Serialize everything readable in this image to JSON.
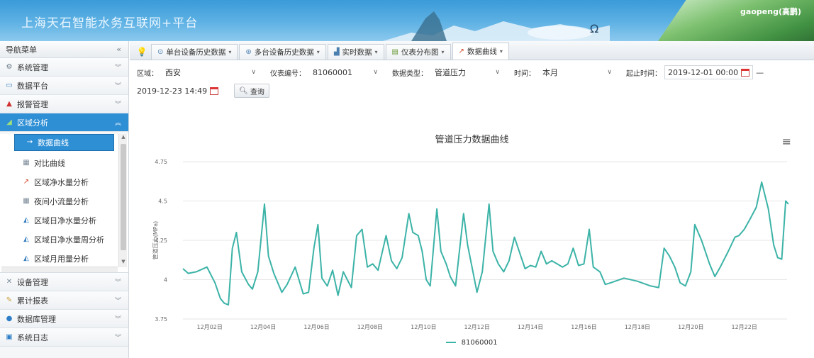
{
  "header": {
    "title": "上海天石智能水务互联网+平台",
    "user": "gaopeng(高鹏)",
    "user_extra": ""
  },
  "sidebar": {
    "title": "导航菜单",
    "collapse": "«",
    "groups": [
      {
        "label": "系统管理",
        "icon": "gear-icon"
      },
      {
        "label": "数据平台",
        "icon": "monitor-icon"
      },
      {
        "label": "报警管理",
        "icon": "alarm-icon"
      },
      {
        "label": "区域分析",
        "icon": "chart-icon"
      }
    ],
    "sub_items": [
      {
        "label": "数据曲线"
      },
      {
        "label": "对比曲线"
      },
      {
        "label": "区域净水量分析"
      },
      {
        "label": "夜间小流量分析"
      },
      {
        "label": "区域日净水量分析"
      },
      {
        "label": "区域日净水量周分析"
      },
      {
        "label": "区域月用量分析"
      }
    ],
    "groups_after": [
      {
        "label": "设备管理",
        "icon": "wrench-icon"
      },
      {
        "label": "累计报表",
        "icon": "report-icon"
      },
      {
        "label": "数据库管理",
        "icon": "database-icon"
      },
      {
        "label": "系统日志",
        "icon": "log-icon"
      }
    ]
  },
  "tabs": [
    {
      "label": "单台设备历史数据",
      "icon": "clock-icon"
    },
    {
      "label": "多台设备历史数据",
      "icon": "clock-icon"
    },
    {
      "label": "实时数据",
      "icon": "chart-icon"
    },
    {
      "label": "仪表分布图",
      "icon": "map-icon"
    },
    {
      "label": "数据曲线",
      "icon": "line-chart-icon"
    }
  ],
  "filters": {
    "region_label": "区域：",
    "region_value": "西安",
    "meter_label": "仪表编号：",
    "meter_value": "81060001",
    "type_label": "数据类型：",
    "type_value": "管道压力",
    "period_label": "时间：",
    "period_value": "本月",
    "start_label": "起止时间：",
    "start_value": "2019-12-01 00:00",
    "sep": "—",
    "end_value": "2019-12-23 14:49",
    "query_label": "查询"
  },
  "chart_data": {
    "type": "line",
    "title": "管道压力数据曲线",
    "ylabel": "管道压力(MPa)",
    "ylim": [
      3.75,
      4.75
    ],
    "yticks": [
      "3.75",
      "4",
      "4.25",
      "4.5",
      "4.75"
    ],
    "xticks": [
      "12月02日",
      "12月04日",
      "12月06日",
      "12月08日",
      "12月10日",
      "12月12日",
      "12月14日",
      "12月16日",
      "12月18日",
      "12月20日",
      "12月22日"
    ],
    "x_start_day": 1,
    "x_end_day": 23.6,
    "series": [
      {
        "name": "81060001",
        "color": "#3cb3a7",
        "points": [
          [
            1.0,
            4.07
          ],
          [
            1.2,
            4.04
          ],
          [
            1.5,
            4.05
          ],
          [
            1.9,
            4.08
          ],
          [
            2.2,
            3.98
          ],
          [
            2.4,
            3.88
          ],
          [
            2.55,
            3.85
          ],
          [
            2.7,
            3.84
          ],
          [
            2.85,
            4.2
          ],
          [
            3.0,
            4.3
          ],
          [
            3.2,
            4.05
          ],
          [
            3.45,
            3.97
          ],
          [
            3.6,
            3.94
          ],
          [
            3.8,
            4.05
          ],
          [
            4.05,
            4.48
          ],
          [
            4.2,
            4.15
          ],
          [
            4.4,
            4.04
          ],
          [
            4.7,
            3.92
          ],
          [
            4.9,
            3.97
          ],
          [
            5.2,
            4.08
          ],
          [
            5.5,
            3.91
          ],
          [
            5.7,
            3.92
          ],
          [
            5.9,
            4.2
          ],
          [
            6.05,
            4.35
          ],
          [
            6.2,
            4.01
          ],
          [
            6.4,
            3.96
          ],
          [
            6.6,
            4.06
          ],
          [
            6.8,
            3.9
          ],
          [
            7.0,
            4.05
          ],
          [
            7.15,
            4.0
          ],
          [
            7.3,
            3.95
          ],
          [
            7.5,
            4.28
          ],
          [
            7.7,
            4.32
          ],
          [
            7.9,
            4.08
          ],
          [
            8.1,
            4.1
          ],
          [
            8.3,
            4.06
          ],
          [
            8.6,
            4.28
          ],
          [
            8.8,
            4.12
          ],
          [
            9.0,
            4.07
          ],
          [
            9.2,
            4.14
          ],
          [
            9.45,
            4.42
          ],
          [
            9.6,
            4.3
          ],
          [
            9.8,
            4.28
          ],
          [
            9.95,
            4.18
          ],
          [
            10.1,
            4.0
          ],
          [
            10.25,
            3.96
          ],
          [
            10.5,
            4.45
          ],
          [
            10.65,
            4.18
          ],
          [
            10.85,
            4.1
          ],
          [
            11.0,
            4.02
          ],
          [
            11.2,
            3.96
          ],
          [
            11.5,
            4.42
          ],
          [
            11.65,
            4.22
          ],
          [
            11.85,
            4.05
          ],
          [
            12.0,
            3.92
          ],
          [
            12.2,
            4.05
          ],
          [
            12.45,
            4.48
          ],
          [
            12.6,
            4.18
          ],
          [
            12.8,
            4.1
          ],
          [
            13.0,
            4.05
          ],
          [
            13.2,
            4.12
          ],
          [
            13.4,
            4.27
          ],
          [
            13.6,
            4.17
          ],
          [
            13.8,
            4.07
          ],
          [
            14.0,
            4.09
          ],
          [
            14.2,
            4.08
          ],
          [
            14.4,
            4.18
          ],
          [
            14.6,
            4.1
          ],
          [
            14.8,
            4.12
          ],
          [
            15.0,
            4.1
          ],
          [
            15.2,
            4.08
          ],
          [
            15.4,
            4.1
          ],
          [
            15.6,
            4.2
          ],
          [
            15.8,
            4.09
          ],
          [
            16.0,
            4.1
          ],
          [
            16.2,
            4.32
          ],
          [
            16.35,
            4.08
          ],
          [
            16.6,
            4.05
          ],
          [
            16.8,
            3.97
          ],
          [
            17.0,
            3.98
          ],
          [
            17.5,
            4.01
          ],
          [
            18.0,
            3.99
          ],
          [
            18.5,
            3.96
          ],
          [
            18.8,
            3.95
          ],
          [
            19.0,
            4.2
          ],
          [
            19.2,
            4.15
          ],
          [
            19.4,
            4.08
          ],
          [
            19.6,
            3.98
          ],
          [
            19.8,
            3.96
          ],
          [
            20.0,
            4.05
          ],
          [
            20.15,
            4.35
          ],
          [
            20.4,
            4.25
          ],
          [
            20.7,
            4.1
          ],
          [
            20.9,
            4.02
          ],
          [
            21.1,
            4.08
          ],
          [
            21.4,
            4.18
          ],
          [
            21.65,
            4.27
          ],
          [
            21.8,
            4.28
          ],
          [
            22.0,
            4.32
          ],
          [
            22.2,
            4.38
          ],
          [
            22.45,
            4.46
          ],
          [
            22.65,
            4.62
          ],
          [
            22.9,
            4.45
          ],
          [
            23.1,
            4.22
          ],
          [
            23.25,
            4.14
          ],
          [
            23.4,
            4.13
          ],
          [
            23.55,
            4.5
          ],
          [
            23.65,
            4.48
          ]
        ]
      }
    ],
    "legend": "81060001"
  }
}
